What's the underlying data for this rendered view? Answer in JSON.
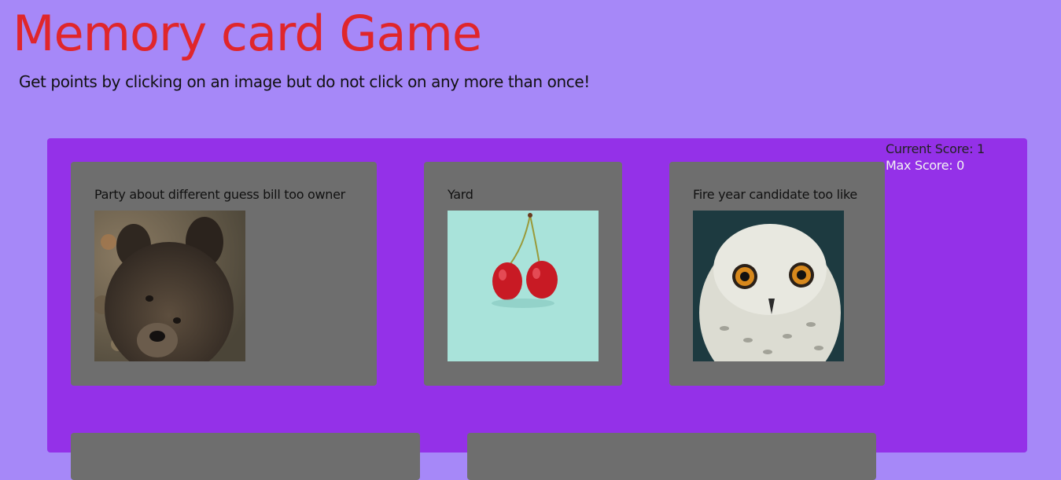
{
  "header": {
    "title": "Memory card Game",
    "subtitle": "Get points by clicking on an image but do not click on any more than once!"
  },
  "score": {
    "current": "Current Score: 1",
    "max": "Max Score: 0"
  },
  "cards": [
    {
      "label": "Party about different guess bill too owner",
      "image": "bear-photo"
    },
    {
      "label": "Yard",
      "image": "cherries-photo"
    },
    {
      "label": "Fire year candidate too like",
      "image": "owl-photo"
    },
    {
      "label": "",
      "image": ""
    },
    {
      "label": "",
      "image": ""
    }
  ],
  "colors": {
    "background": "#a688f8",
    "board": "#9431e8",
    "card": "#6e6e6e",
    "title": "#e0262b"
  }
}
